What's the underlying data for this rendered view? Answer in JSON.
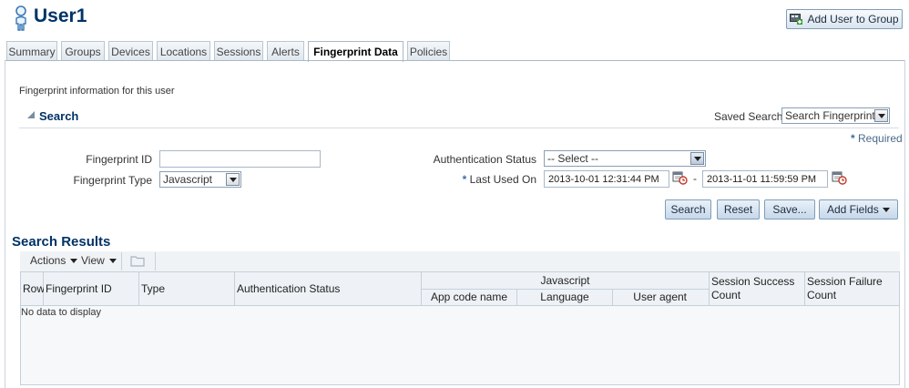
{
  "header": {
    "title": "User1",
    "add_user_to_group_label": "Add User to Group"
  },
  "tabs": [
    {
      "label": "Summary",
      "active": false
    },
    {
      "label": "Groups",
      "active": false
    },
    {
      "label": "Devices",
      "active": false
    },
    {
      "label": "Locations",
      "active": false
    },
    {
      "label": "Sessions",
      "active": false
    },
    {
      "label": "Alerts",
      "active": false
    },
    {
      "label": "Fingerprint Data",
      "active": true
    },
    {
      "label": "Policies",
      "active": false
    }
  ],
  "content": {
    "info_text": "Fingerprint information for this user",
    "search": {
      "title": "Search",
      "saved_search_label": "Saved Search",
      "saved_search_value": "Search Fingerprints",
      "required_text": "Required",
      "required_marker": "*",
      "fingerprint_id_label": "Fingerprint ID",
      "fingerprint_id_value": "",
      "fingerprint_type_label": "Fingerprint Type",
      "fingerprint_type_value": "Javascript",
      "auth_status_label": "Authentication Status",
      "auth_status_value": "-- Select --",
      "last_used_label": "Last Used On",
      "last_used_from": "2013-10-01 12:31:44 PM",
      "last_used_to": "2013-11-01 11:59:59 PM",
      "range_separator": "-",
      "buttons": {
        "search": "Search",
        "reset": "Reset",
        "save": "Save...",
        "add_fields": "Add Fields"
      }
    },
    "results": {
      "title": "Search Results",
      "toolbar": {
        "actions": "Actions",
        "view": "View"
      },
      "columns": {
        "row": "Row",
        "fingerprint_id": "Fingerprint ID",
        "type": "Type",
        "auth_status": "Authentication Status",
        "javascript_group": "Javascript",
        "app_code_name": "App code name",
        "language": "Language",
        "user_agent": "User agent",
        "session_success": "Session Success Count",
        "session_failure": "Session Failure Count"
      },
      "empty_text": "No data to display"
    }
  },
  "colors": {
    "title": "#003366",
    "accent": "#3a6ea5"
  }
}
